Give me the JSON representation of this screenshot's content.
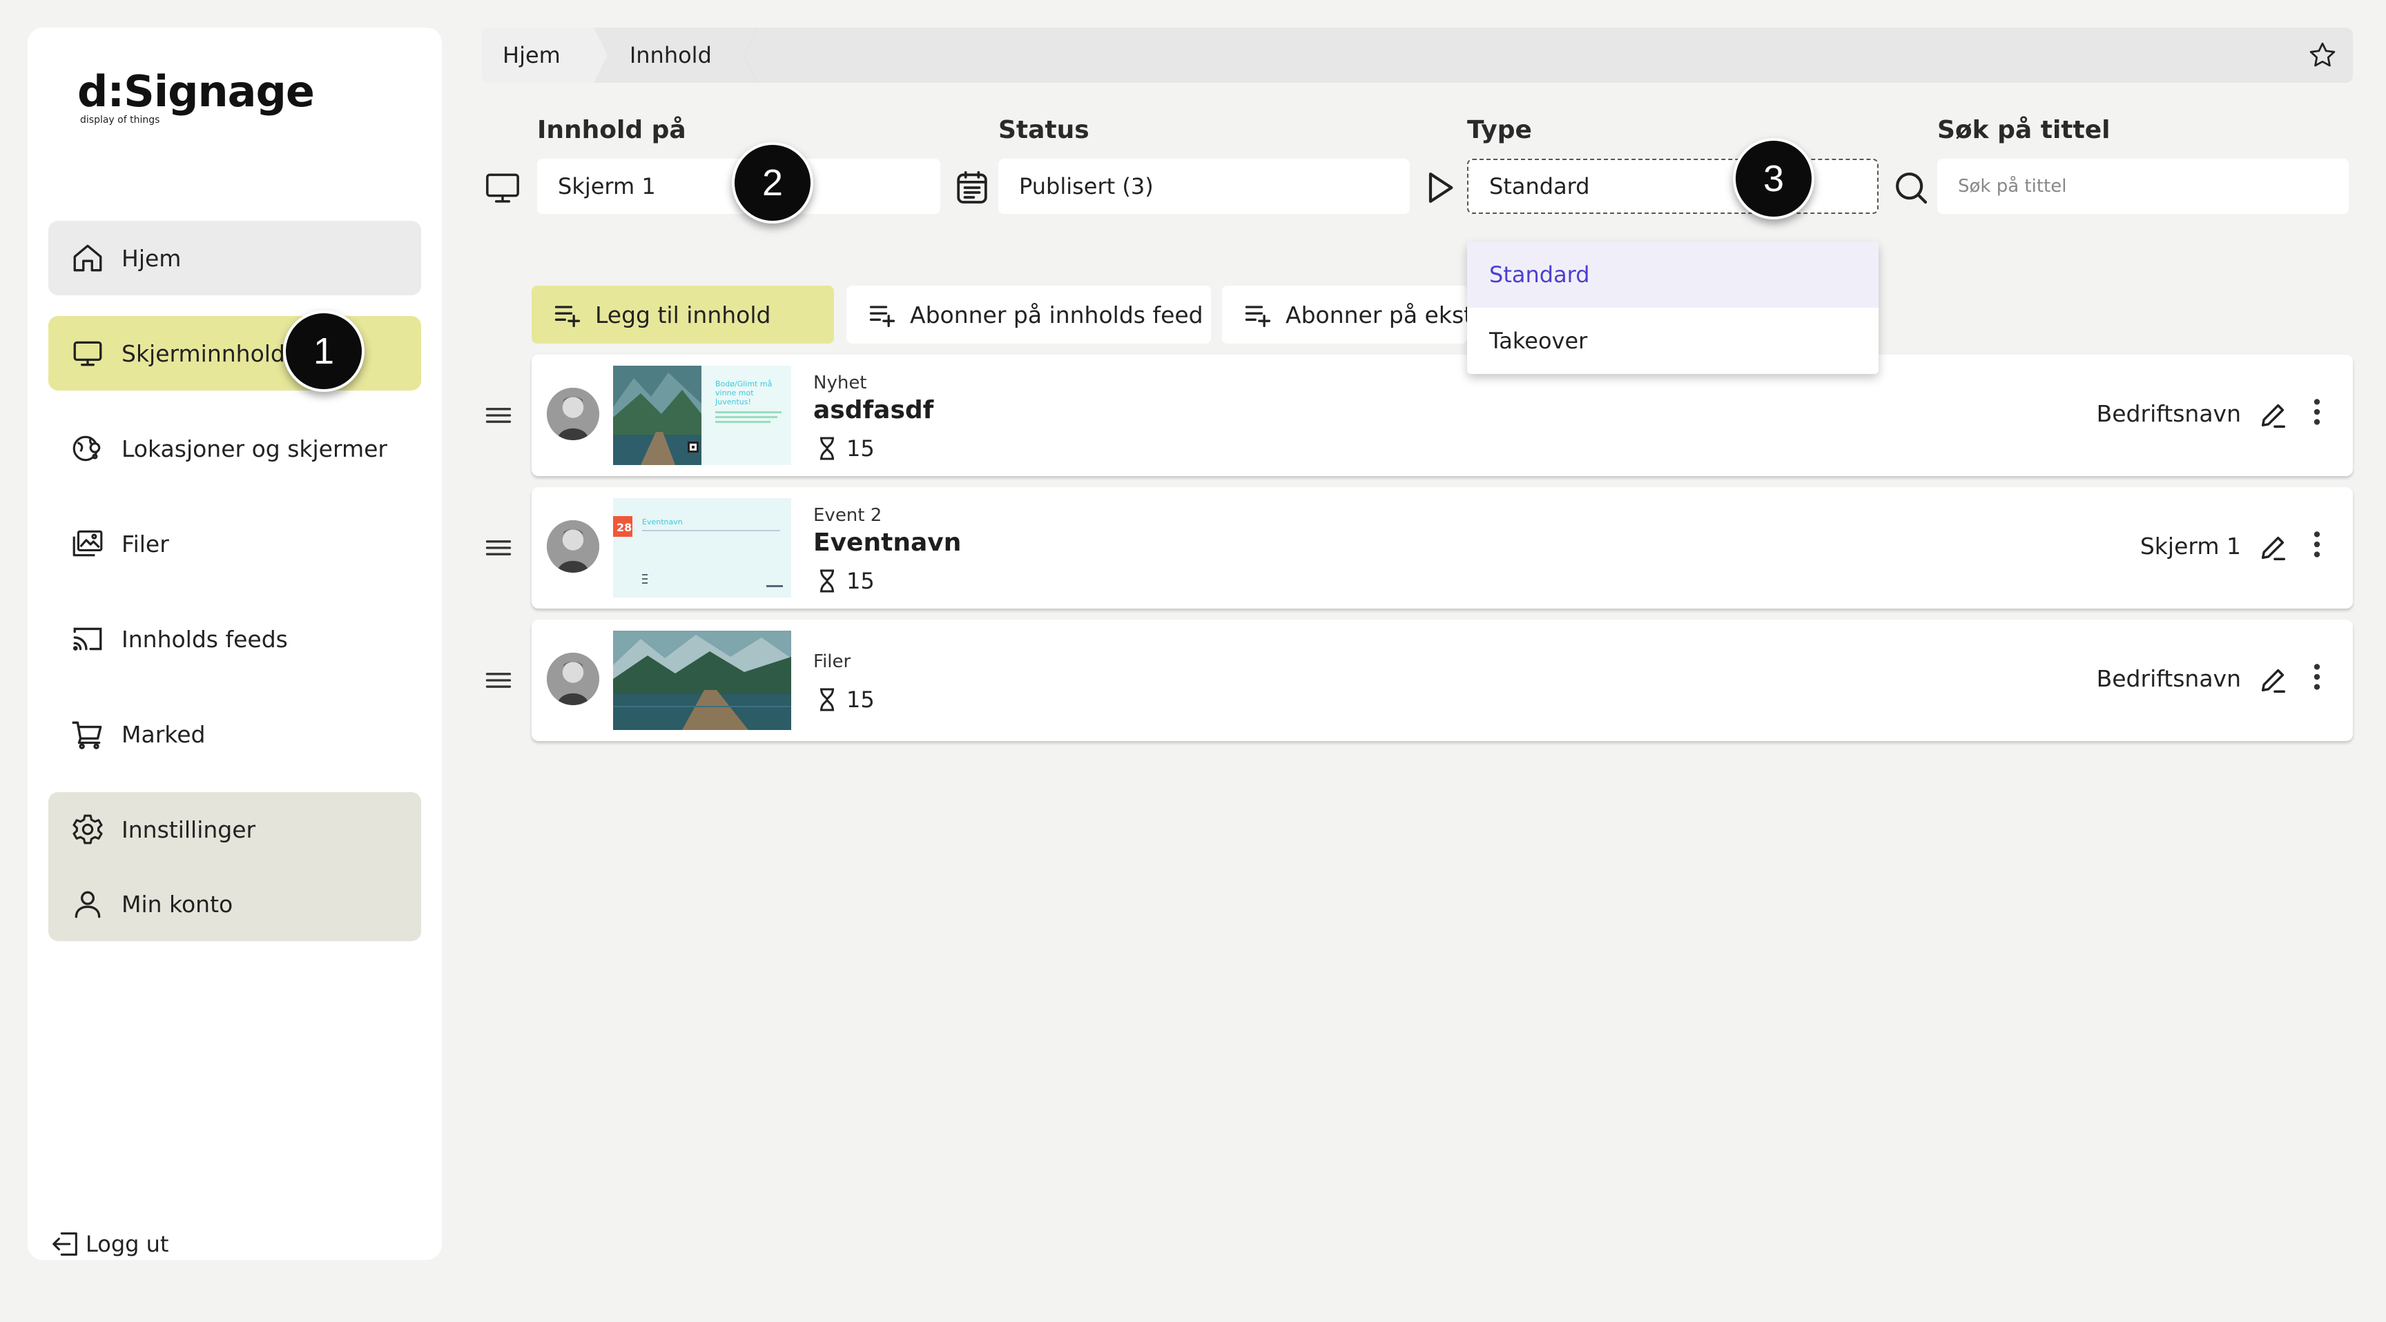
{
  "logo": {
    "main": "d:Signage",
    "tagline": "display of things"
  },
  "sidebar": {
    "items": [
      {
        "label": "Hjem",
        "icon": "home-icon"
      },
      {
        "label": "Skjerminnhold",
        "icon": "monitor-icon"
      },
      {
        "label": "Lokasjoner og skjermer",
        "icon": "location-icon"
      },
      {
        "label": "Filer",
        "icon": "image-icon"
      },
      {
        "label": "Innholds feeds",
        "icon": "cast-icon"
      },
      {
        "label": "Marked",
        "icon": "cart-icon"
      }
    ],
    "settings": [
      {
        "label": "Innstillinger",
        "icon": "gear-icon"
      },
      {
        "label": "Min konto",
        "icon": "user-icon"
      }
    ],
    "logout": "Logg ut"
  },
  "badges": [
    "1",
    "2",
    "3"
  ],
  "breadcrumb": [
    "Hjem",
    "Innhold"
  ],
  "filters": {
    "content_on": {
      "label": "Innhold på",
      "value": "Skjerm 1"
    },
    "status": {
      "label": "Status",
      "value": "Publisert (3)"
    },
    "type": {
      "label": "Type",
      "value": "Standard",
      "options": [
        "Standard",
        "Takeover"
      ]
    },
    "search": {
      "label": "Søk på tittel",
      "placeholder": "Søk på tittel"
    }
  },
  "actions": {
    "add": "Legg til innhold",
    "subscribe_feed": "Abonner på innholds feed",
    "subscribe_external": "Abonner på ekste"
  },
  "rows": [
    {
      "kind": "Nyhet",
      "title": "asdfasdf",
      "duration": "15",
      "owner": "Bedriftsnavn",
      "thumb_text": [
        "Bodø/Glimt må",
        "vinne mot",
        "Juventus!"
      ]
    },
    {
      "kind": "Event 2",
      "title": "Eventnavn",
      "duration": "15",
      "owner": "Skjerm 1",
      "thumb_date": "28",
      "thumb_title": "Eventnavn"
    },
    {
      "kind": "Filer",
      "title": "",
      "duration": "15",
      "owner": "Bedriftsnavn"
    }
  ],
  "colors": {
    "accent_yellow": "#e7e79a",
    "selected_option": "#4c3fd1",
    "thumb_teal": "#3ccad9"
  }
}
